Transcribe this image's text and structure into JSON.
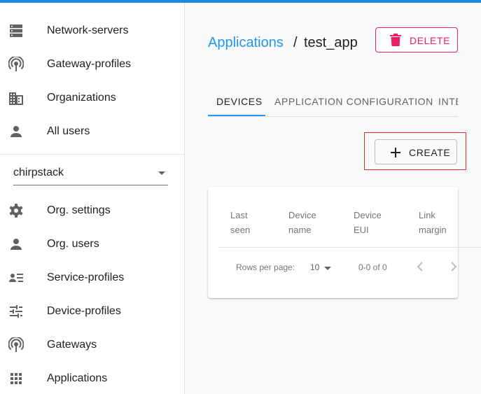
{
  "colors": {
    "accent": "#2196f3",
    "danger": "#e91e63",
    "highlight": "#d32f2f",
    "topbar": "#1e88e5"
  },
  "sidebar": {
    "top_items": [
      {
        "label": "Network-servers",
        "icon": "server-icon"
      },
      {
        "label": "Gateway-profiles",
        "icon": "radio-tower-icon"
      },
      {
        "label": "Organizations",
        "icon": "building-icon"
      },
      {
        "label": "All users",
        "icon": "person-icon"
      }
    ],
    "organization_select": {
      "value": "chirpstack"
    },
    "org_items": [
      {
        "label": "Org. settings",
        "icon": "gear-icon"
      },
      {
        "label": "Org. users",
        "icon": "person-icon"
      },
      {
        "label": "Service-profiles",
        "icon": "account-list-icon"
      },
      {
        "label": "Device-profiles",
        "icon": "sliders-icon"
      },
      {
        "label": "Gateways",
        "icon": "radio-tower-icon"
      },
      {
        "label": "Applications",
        "icon": "apps-grid-icon"
      }
    ]
  },
  "header": {
    "breadcrumb_link": "Applications",
    "breadcrumb_separator": "/",
    "current_app": "test_app",
    "delete_label": "DELETE"
  },
  "tabs": [
    {
      "label": "DEVICES",
      "active": true
    },
    {
      "label": "APPLICATION CONFIGURATION",
      "active": false
    },
    {
      "label": "INTE",
      "active": false
    }
  ],
  "toolbar": {
    "create_label": "CREATE"
  },
  "table": {
    "columns": [
      {
        "line1": "Last",
        "line2": "seen"
      },
      {
        "line1": "Device",
        "line2": "name"
      },
      {
        "line1": "Device",
        "line2": "EUI"
      },
      {
        "line1": "Link",
        "line2": "margin"
      }
    ],
    "rows": [],
    "footer": {
      "rows_per_page_label": "Rows per page:",
      "rows_per_page_value": "10",
      "range": "0-0 of 0"
    }
  }
}
